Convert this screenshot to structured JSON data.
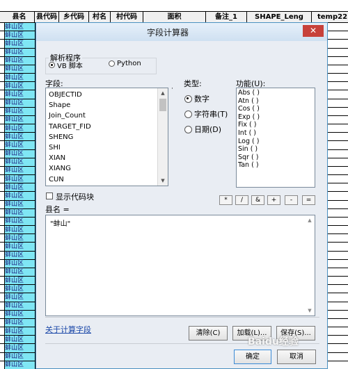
{
  "table": {
    "columns": [
      "县名",
      "县代码",
      "乡代码",
      "村名",
      "村代码",
      "面积",
      "备注_1",
      "SHAPE_Leng",
      "temp22"
    ],
    "cell_value": "蚌山区",
    "row_count": 41
  },
  "dialog": {
    "title": "字段计算器",
    "close_glyph": "✕",
    "parser": {
      "legend": "解析程序",
      "options": [
        {
          "label": "VB 脚本",
          "selected": true
        },
        {
          "label": "Python",
          "selected": false
        }
      ]
    },
    "fields_label": "字段:",
    "fields": [
      "OBJECTID",
      "Shape",
      "Join_Count",
      "TARGET_FID",
      "SHENG",
      "SHI",
      "XIAN",
      "XIANG",
      "CUN"
    ],
    "type": {
      "label": "类型:",
      "options": [
        {
          "label": "数字",
          "selected": true
        },
        {
          "label": "字符串(T)",
          "selected": false
        },
        {
          "label": "日期(D)",
          "selected": false
        }
      ]
    },
    "functions_label": "功能(U):",
    "functions": [
      "Abs ( )",
      "Atn ( )",
      "Cos ( )",
      "Exp ( )",
      "Fix ( )",
      "Int ( )",
      "Log ( )",
      "Sin ( )",
      "Sqr ( )",
      "Tan ( )"
    ],
    "show_codeblock": {
      "label": "显示代码块",
      "checked": false
    },
    "operators": [
      "*",
      "/",
      "&",
      "+",
      "-",
      "="
    ],
    "expression_label": "县名 =",
    "expression": "\"蚌山\"",
    "help_link": "关于计算字段",
    "buttons": {
      "clear": "清除(C)",
      "load": "加载(L)...",
      "save": "保存(S)...",
      "ok": "确定",
      "cancel": "取消"
    }
  },
  "watermark": "Baidu经验"
}
